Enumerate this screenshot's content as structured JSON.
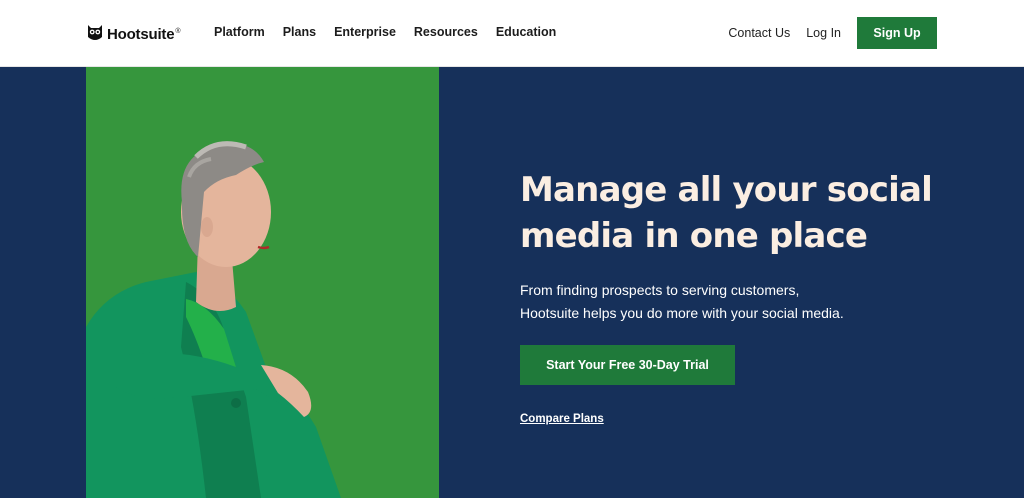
{
  "nav": {
    "logo": {
      "text": "Hootsuite",
      "mark": "®",
      "icon": "owl-logo-icon"
    },
    "links": [
      "Platform",
      "Plans",
      "Enterprise",
      "Resources",
      "Education"
    ],
    "contact_label": "Contact Us",
    "login_label": "Log In",
    "signup_label": "Sign Up"
  },
  "hero": {
    "title": "Manage all your social media in one place",
    "subtitle_line1": "From finding prospects to serving customers,",
    "subtitle_line2": "Hootsuite helps you do more with your social media.",
    "cta_label": "Start Your Free 30-Day Trial",
    "compare_label": "Compare Plans"
  },
  "colors": {
    "brand_green": "#1f7a3a",
    "hero_navy": "#16305a",
    "photo_green": "#36963d",
    "title_cream": "#fbeee2"
  }
}
